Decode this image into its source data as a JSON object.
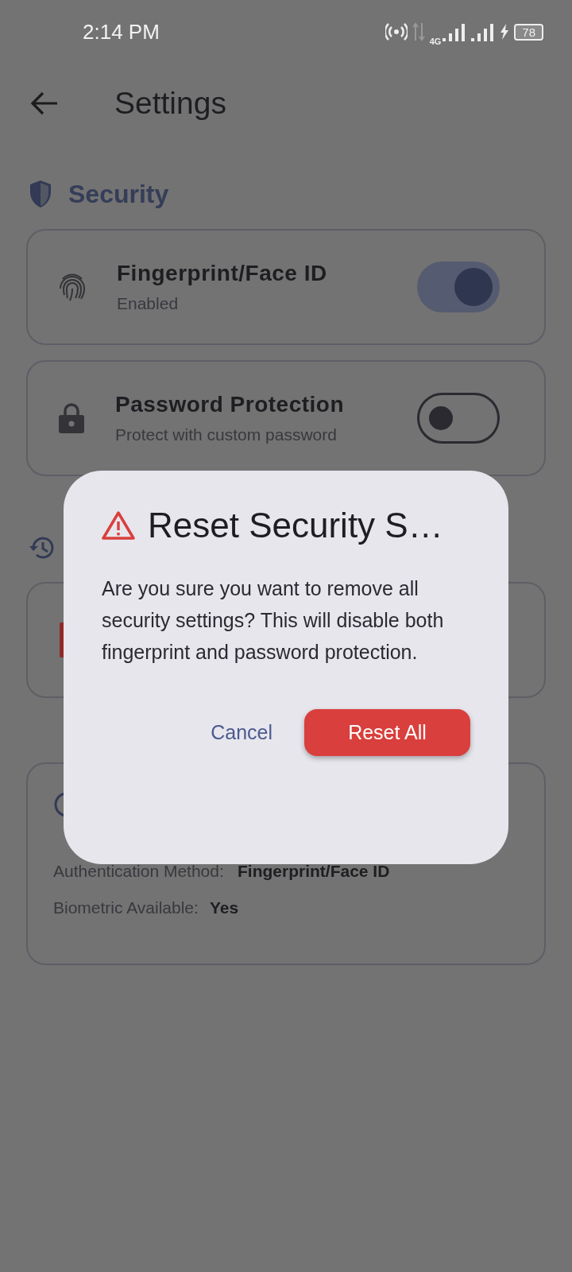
{
  "status_bar": {
    "time": "2:14 PM",
    "network": "4G",
    "battery": "78"
  },
  "header": {
    "title": "Settings"
  },
  "security": {
    "title": "Security",
    "items": [
      {
        "title": "Fingerprint/Face ID",
        "subtitle": "Enabled",
        "on": true
      },
      {
        "title": "Password Protection",
        "subtitle": "Protect with custom password",
        "on": false
      }
    ]
  },
  "status_card": {
    "rows": [
      {
        "label": "Authentication Method:",
        "value": "Fingerprint/Face ID"
      },
      {
        "label": "Biometric Available:",
        "value": "Yes"
      }
    ]
  },
  "dialog": {
    "title": "Reset Security S…",
    "message": "Are you sure you want to remove all security settings? This will disable both fingerprint and password protection.",
    "buttons": [
      {
        "label": "Cancel",
        "kind": "text"
      },
      {
        "label": "Reset All",
        "kind": "filled"
      }
    ]
  }
}
